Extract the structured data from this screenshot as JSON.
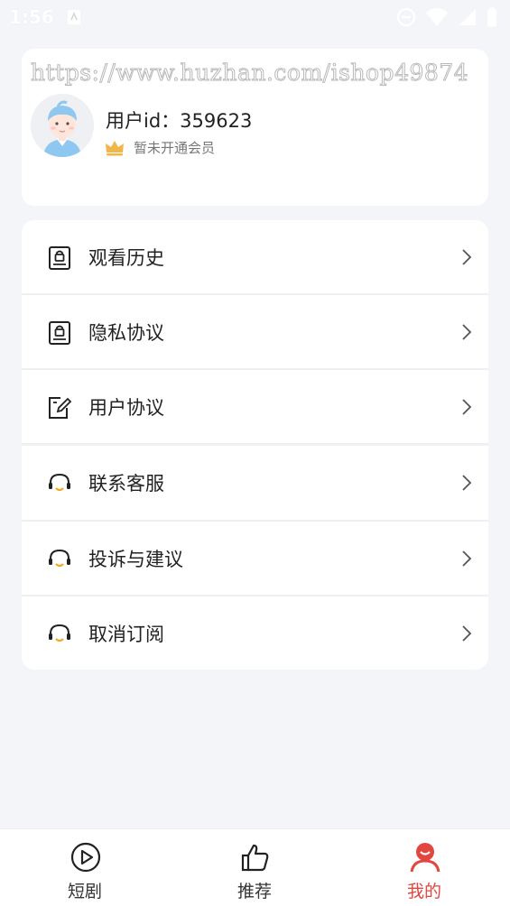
{
  "status_bar": {
    "time": "1:56",
    "left_icon": "android-notification-icon",
    "right_icons": [
      "do-not-disturb-icon",
      "wifi-icon",
      "battery-icon"
    ]
  },
  "profile": {
    "watermark": "https://www.huzhan.com/ishop49874",
    "user_id_label": "用户id：359623",
    "vip_status": "暂未开通会员",
    "avatar_icon": "user-avatar-icon",
    "crown_icon": "crown-icon"
  },
  "menu": {
    "items": [
      {
        "label": "观看历史",
        "icon": "lock-book-icon"
      },
      {
        "label": "隐私协议",
        "icon": "lock-book-icon"
      },
      {
        "label": "用户协议",
        "icon": "edit-document-icon"
      },
      {
        "label": "联系客服",
        "icon": "headset-icon"
      },
      {
        "label": "投诉与建议",
        "icon": "headset-icon"
      },
      {
        "label": "取消订阅",
        "icon": "headset-icon"
      }
    ]
  },
  "bottom_nav": {
    "items": [
      {
        "label": "短剧",
        "icon": "play-circle-icon",
        "active": false
      },
      {
        "label": "推荐",
        "icon": "thumbs-up-icon",
        "active": false
      },
      {
        "label": "我的",
        "icon": "profile-smile-icon",
        "active": true
      }
    ]
  },
  "colors": {
    "background": "#f4f5f9",
    "card": "#ffffff",
    "accent": "#e1473f",
    "crown": "#f0b64a",
    "headset_smile": "#f5a623"
  }
}
